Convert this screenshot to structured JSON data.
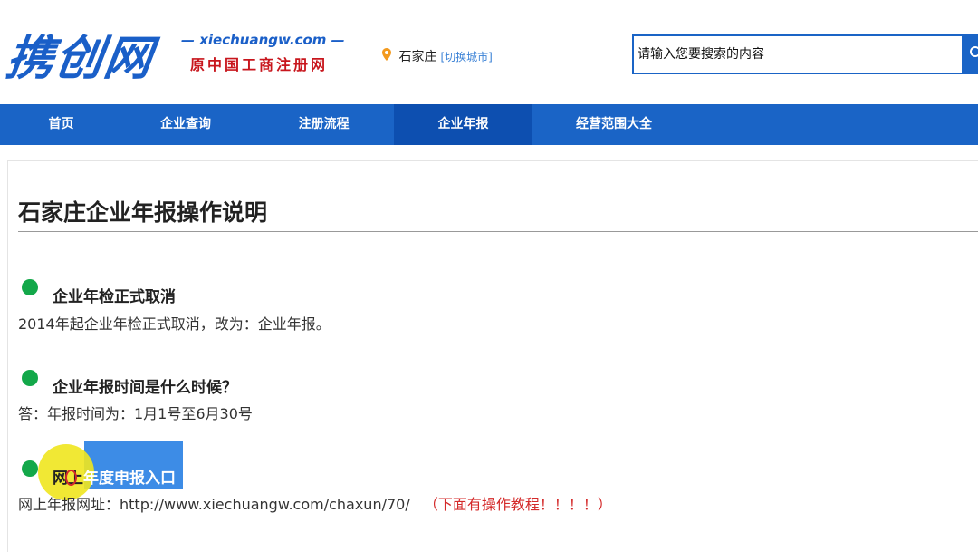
{
  "header": {
    "logo_text": "携创网",
    "logo_domain": "— xiechuangw.com —",
    "logo_subtitle": "原中国工商注册网",
    "city": "石家庄",
    "city_switch": "[切换城市]"
  },
  "search": {
    "placeholder": "请输入您要搜索的内容"
  },
  "nav": {
    "items": [
      {
        "label": "首页"
      },
      {
        "label": "企业查询"
      },
      {
        "label": "注册流程"
      },
      {
        "label": "企业年报"
      },
      {
        "label": "经营范围大全"
      }
    ],
    "active_index": 3
  },
  "main": {
    "title": "石家庄企业年报操作说明",
    "sections": [
      {
        "title": "企业年检正式取消",
        "body": "2014年起企业年检正式取消，改为：企业年报。"
      },
      {
        "title": "企业年报时间是什么时候？",
        "body": "答：年报时间为：1月1号至6月30号"
      },
      {
        "title": "网上年度申报入口",
        "title_prefix": "网上",
        "title_rest": "年度申报入口",
        "body": "网上年报网址：http://www.xiechuangw.com/chaxun/70/",
        "note": "（下面有操作教程！！！！）"
      }
    ]
  },
  "colors": {
    "brand_blue": "#1a64c6",
    "active_nav": "#0d4fb0",
    "bullet_green": "#13a84a",
    "logo_red": "#c8161d",
    "note_red": "#d42a2a"
  }
}
